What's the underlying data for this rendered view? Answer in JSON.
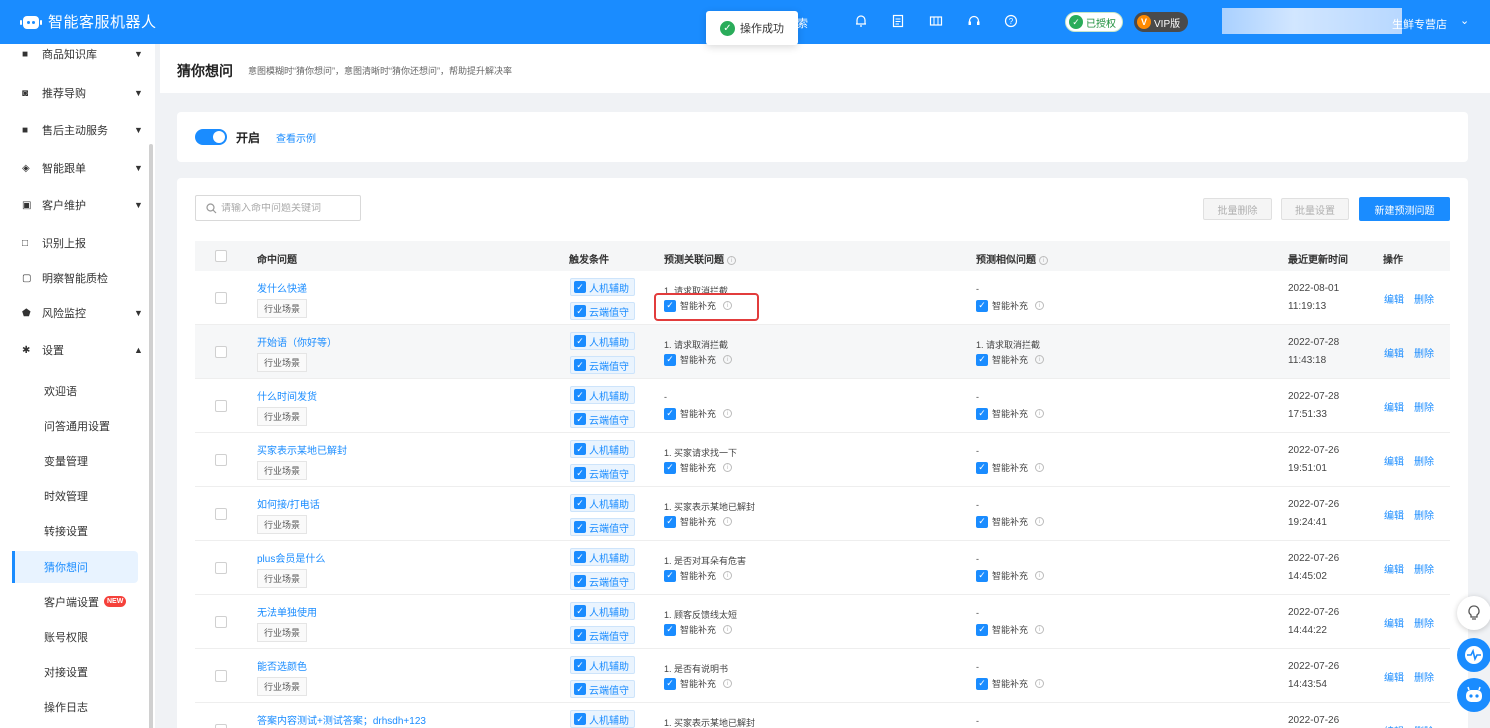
{
  "app": {
    "title": "智能客服机器人"
  },
  "toast": {
    "text": "操作成功"
  },
  "topbar": {
    "partial_text": "索",
    "auth_badge": "已授权",
    "vip_badge": "VIP版",
    "user_name": "生鲜专营店"
  },
  "sidebar": {
    "items": [
      {
        "label": "商品知识库",
        "icon": "book-icon",
        "expandable": true
      },
      {
        "label": "推荐导购",
        "icon": "guide-icon",
        "expandable": true
      },
      {
        "label": "售后主动服务",
        "icon": "service-icon",
        "expandable": true
      },
      {
        "label": "智能跟单",
        "icon": "layers-icon",
        "expandable": true
      },
      {
        "label": "客户维护",
        "icon": "card-icon",
        "expandable": true
      },
      {
        "label": "识别上报",
        "icon": "report-icon",
        "expandable": false
      },
      {
        "label": "明察智能质检",
        "icon": "inspect-icon",
        "expandable": false
      },
      {
        "label": "风险监控",
        "icon": "shield-icon",
        "expandable": true
      },
      {
        "label": "设置",
        "icon": "gear-icon",
        "expandable": true
      }
    ],
    "settings_sub": [
      "欢迎语",
      "问答通用设置",
      "变量管理",
      "时效管理",
      "转接设置",
      "猜你想问",
      "客户端设置",
      "账号权限",
      "对接设置",
      "操作日志"
    ],
    "active_sub": "猜你想问",
    "new_badge": "NEW"
  },
  "header": {
    "title": "猜你想问",
    "desc": "意图模糊时“猜你想问”，意图清晰时“猜你还想问”，帮助提升解决率"
  },
  "toggle": {
    "label": "开启",
    "on": true,
    "example_link": "查看示例"
  },
  "toolbar": {
    "search_placeholder": "请输入命中问题关键词",
    "batch_delete": "批量删除",
    "batch_settings": "批量设置",
    "new_button": "新建预测问题"
  },
  "table": {
    "headers": {
      "question": "命中问题",
      "trigger": "触发条件",
      "assoc": "预测关联问题",
      "similar": "预测相似问题",
      "updated": "最近更新时间",
      "ops": "操作"
    },
    "scene_label": "行业场景",
    "tag_human": "人机辅助",
    "tag_cloud": "云端值守",
    "smart_label": "智能补充",
    "edit": "编辑",
    "delete": "删除",
    "rows": [
      {
        "question": "发什么快递",
        "assoc": "1. 请求取消拦截",
        "similar": "-",
        "date": "2022-08-01",
        "time": "11:19:13"
      },
      {
        "question": "开始语（你好等）",
        "assoc": "1. 请求取消拦截",
        "similar": "1. 请求取消拦截",
        "date": "2022-07-28",
        "time": "11:43:18"
      },
      {
        "question": "什么时间发货",
        "assoc": "-",
        "similar": "-",
        "date": "2022-07-28",
        "time": "17:51:33"
      },
      {
        "question": "买家表示某地已解封",
        "assoc": "1. 买家请求找一下",
        "similar": "-",
        "date": "2022-07-26",
        "time": "19:51:01"
      },
      {
        "question": "如何接/打电话",
        "assoc": "1. 买家表示某地已解封",
        "similar": "-",
        "date": "2022-07-26",
        "time": "19:24:41"
      },
      {
        "question": "plus会员是什么",
        "assoc": "1. 是否对耳朵有危害",
        "similar": "-",
        "date": "2022-07-26",
        "time": "14:45:02"
      },
      {
        "question": "无法单独使用",
        "assoc": "1. 顾客反馈线太短",
        "similar": "-",
        "date": "2022-07-26",
        "time": "14:44:22"
      },
      {
        "question": "能否选颜色",
        "assoc": "1. 是否有说明书",
        "similar": "-",
        "date": "2022-07-26",
        "time": "14:43:54"
      },
      {
        "question": "答案内容测试+测试答案；drhsdh+123",
        "assoc": "1. 买家表示某地已解封",
        "similar": "-",
        "date": "2022-07-26",
        "time": ""
      }
    ]
  }
}
